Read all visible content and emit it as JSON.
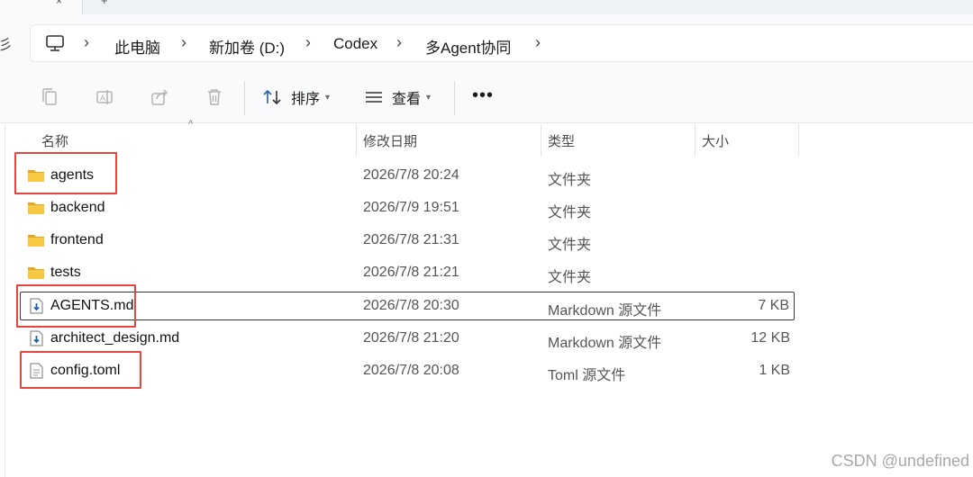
{
  "tabs": {
    "close_glyph": "×",
    "new_tab_glyph": "+"
  },
  "nav": {
    "edge_glyph": "彡"
  },
  "breadcrumb": {
    "items": [
      "此电脑",
      "新加卷 (D:)",
      "Codex",
      "多Agent协同"
    ],
    "separator": "›"
  },
  "toolbar": {
    "sort_label": "排序",
    "view_label": "查看",
    "more_label": "•••",
    "icons": [
      "copy-icon",
      "rename-icon",
      "share-icon",
      "delete-icon",
      "sort-icon",
      "view-icon"
    ]
  },
  "columns": {
    "name": "名称",
    "date": "修改日期",
    "type": "类型",
    "size": "大小",
    "sort_indicator": "^"
  },
  "files": [
    {
      "name": "agents",
      "date": "2026/7/8 20:24",
      "type": "文件夹",
      "size": "",
      "icon": "folder-icon"
    },
    {
      "name": "backend",
      "date": "2026/7/9 19:51",
      "type": "文件夹",
      "size": "",
      "icon": "folder-icon"
    },
    {
      "name": "frontend",
      "date": "2026/7/8 21:31",
      "type": "文件夹",
      "size": "",
      "icon": "folder-icon"
    },
    {
      "name": "tests",
      "date": "2026/7/8 21:21",
      "type": "文件夹",
      "size": "",
      "icon": "folder-icon"
    },
    {
      "name": "AGENTS.md",
      "date": "2026/7/8 20:30",
      "type": "Markdown 源文件",
      "size": "7 KB",
      "icon": "markdown-file-icon",
      "selected": true
    },
    {
      "name": "architect_design.md",
      "date": "2026/7/8 21:20",
      "type": "Markdown 源文件",
      "size": "12 KB",
      "icon": "markdown-file-icon"
    },
    {
      "name": "config.toml",
      "date": "2026/7/8 20:08",
      "type": "Toml 源文件",
      "size": "1 KB",
      "icon": "text-file-icon"
    }
  ],
  "highlighted_items": [
    "agents",
    "AGENTS.md",
    "config.toml"
  ],
  "colors": {
    "highlight_box": "#e8453c",
    "folder": "#f8c843",
    "folder_dark": "#e2a826",
    "selection_border": "#383838"
  },
  "watermark": "CSDN @undefined"
}
